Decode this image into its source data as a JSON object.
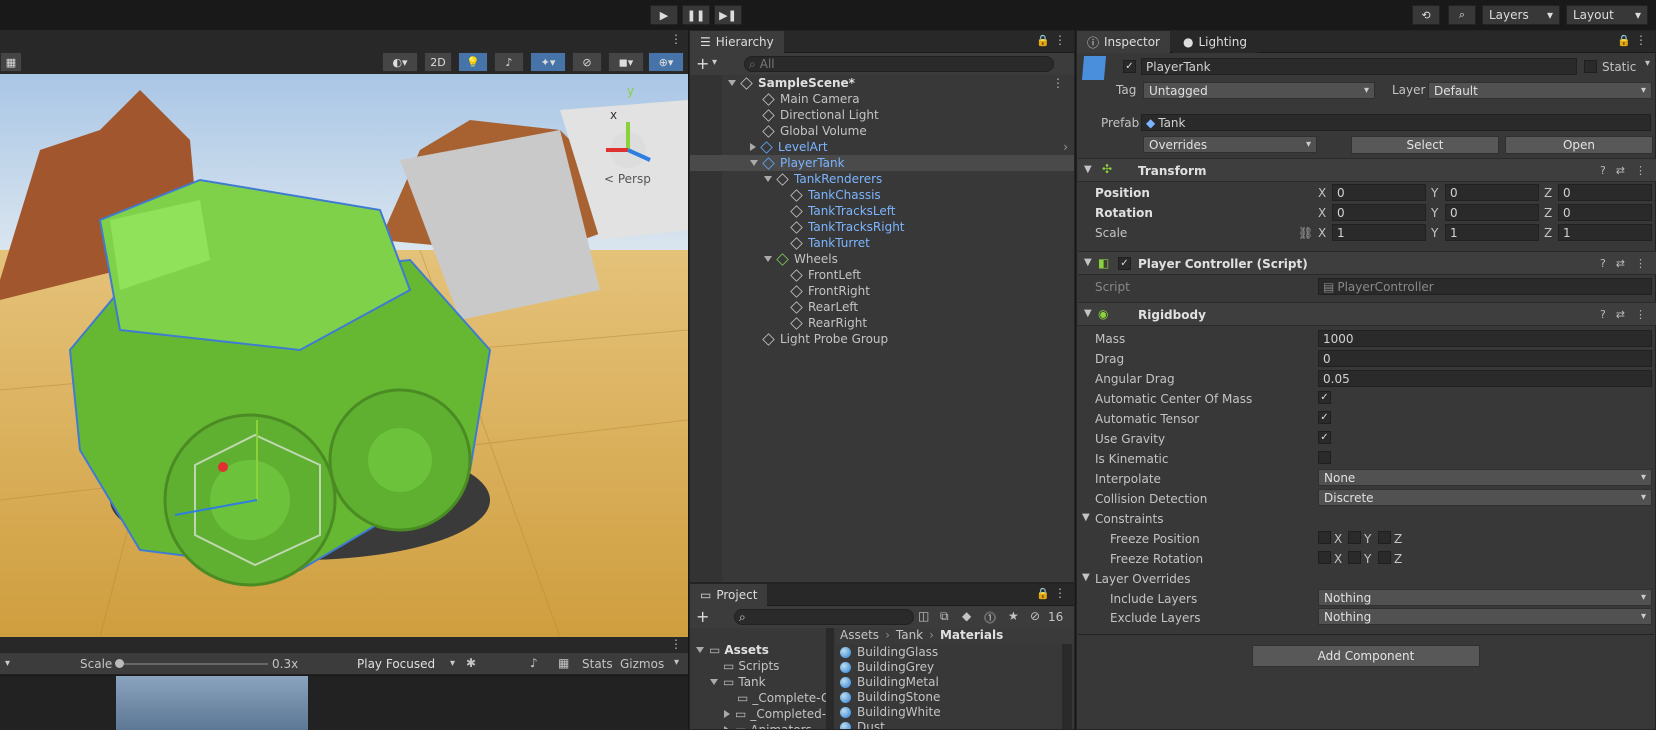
{
  "toolbar": {
    "play": "▶",
    "pause": "❚❚",
    "step": "▶❚",
    "history_icon": "⟲",
    "search_icon": "⌕",
    "layers": "Layers",
    "layout": "Layout"
  },
  "scene": {
    "btn_2d": "2D",
    "persp": "< Persp",
    "axis_y": "y",
    "axis_x": "x"
  },
  "game": {
    "scale_label": "Scale",
    "scale_value": "0.3x",
    "play_mode": "Play Focused",
    "stats": "Stats",
    "gizmos": "Gizmos"
  },
  "hierarchy": {
    "tab": "Hierarchy",
    "search_placeholder": "All",
    "add": "+",
    "items": [
      {
        "label": "SampleScene*",
        "depth": 0
      },
      {
        "label": "Main Camera",
        "depth": 1
      },
      {
        "label": "Directional Light",
        "depth": 1
      },
      {
        "label": "Global Volume",
        "depth": 1
      },
      {
        "label": "LevelArt",
        "depth": 1
      },
      {
        "label": "PlayerTank",
        "depth": 1
      },
      {
        "label": "TankRenderers",
        "depth": 2
      },
      {
        "label": "TankChassis",
        "depth": 3
      },
      {
        "label": "TankTracksLeft",
        "depth": 3
      },
      {
        "label": "TankTracksRight",
        "depth": 3
      },
      {
        "label": "TankTurret",
        "depth": 3
      },
      {
        "label": "Wheels",
        "depth": 2
      },
      {
        "label": "FrontLeft",
        "depth": 3
      },
      {
        "label": "FrontRight",
        "depth": 3
      },
      {
        "label": "RearLeft",
        "depth": 3
      },
      {
        "label": "RearRight",
        "depth": 3
      },
      {
        "label": "Light Probe Group",
        "depth": 1
      }
    ]
  },
  "project": {
    "tab": "Project",
    "count": "16",
    "breadcrumb": [
      "Assets",
      "Tank",
      "Materials"
    ],
    "tree": [
      "Assets",
      "Scripts",
      "Tank",
      "_Complete-G",
      "_Completed-",
      "Animators"
    ],
    "files": [
      "BuildingGlass",
      "BuildingGrey",
      "BuildingMetal",
      "BuildingStone",
      "BuildingWhite",
      "Dust"
    ]
  },
  "inspector": {
    "tab": "Inspector",
    "tab2": "Lighting",
    "name": "PlayerTank",
    "static": "Static",
    "tag_label": "Tag",
    "tag": "Untagged",
    "layer_label": "Layer",
    "layer": "Default",
    "prefab_label": "Prefab",
    "prefab": "Tank",
    "overrides": "Overrides",
    "select": "Select",
    "open": "Open",
    "transform": {
      "title": "Transform",
      "position": "Position",
      "rotation": "Rotation",
      "scale": "Scale",
      "pos": [
        "0",
        "0",
        "0"
      ],
      "rot": [
        "0",
        "0",
        "0"
      ],
      "scl": [
        "1",
        "1",
        "1"
      ],
      "x": "X",
      "y": "Y",
      "z": "Z"
    },
    "controller": {
      "title": "Player Controller (Script)",
      "script_label": "Script",
      "script": "PlayerController"
    },
    "rigidbody": {
      "title": "Rigidbody",
      "mass_label": "Mass",
      "mass": "1000",
      "drag_label": "Drag",
      "drag": "0",
      "angdrag_label": "Angular Drag",
      "angdrag": "0.05",
      "acom": "Automatic Center Of Mass",
      "atensor": "Automatic Tensor",
      "gravity": "Use Gravity",
      "kinematic": "Is Kinematic",
      "interp_label": "Interpolate",
      "interp": "None",
      "coll_label": "Collision Detection",
      "coll": "Discrete",
      "constraints": "Constraints",
      "fpos": "Freeze Position",
      "frot": "Freeze Rotation",
      "layer_overrides": "Layer Overrides",
      "incl_label": "Include Layers",
      "incl": "Nothing",
      "excl_label": "Exclude Layers",
      "excl": "Nothing"
    },
    "add_component": "Add Component"
  }
}
